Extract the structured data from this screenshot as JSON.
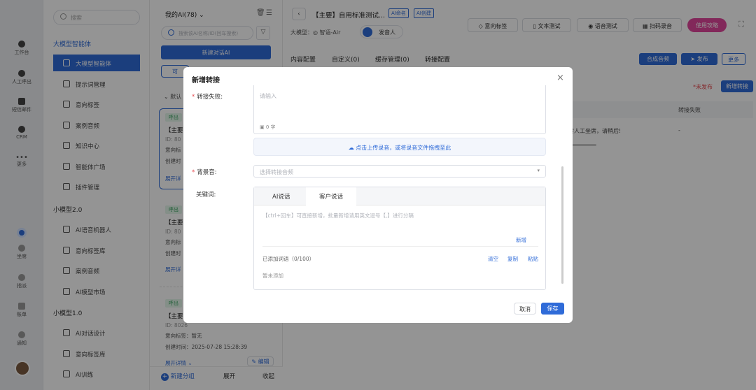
{
  "rail": {
    "items": [
      {
        "label": "工作台",
        "icon": "workbench-icon"
      },
      {
        "label": "人工呼出",
        "icon": "phone-icon"
      },
      {
        "label": "短信邮件",
        "icon": "message-icon"
      },
      {
        "label": "CRM",
        "icon": "crm-icon"
      },
      {
        "label": "更多",
        "icon": "more-icon"
      },
      {
        "label": "坐席",
        "icon": "headset-icon"
      },
      {
        "label": "指派",
        "icon": "assign-icon"
      },
      {
        "label": "账单",
        "icon": "bill-icon"
      },
      {
        "label": "通知",
        "icon": "bell-icon"
      }
    ]
  },
  "nav": {
    "search_placeholder": "搜索",
    "section1": "大模型智能体",
    "group1": [
      {
        "label": "大模型智能体",
        "icon": "agent-icon"
      },
      {
        "label": "提示词管理",
        "icon": "prompt-icon"
      },
      {
        "label": "意向标签",
        "icon": "tag-icon"
      },
      {
        "label": "案例音频",
        "icon": "audio-icon"
      },
      {
        "label": "知识中心",
        "icon": "book-icon"
      },
      {
        "label": "智能体广场",
        "icon": "square-icon"
      },
      {
        "label": "插件管理",
        "icon": "plugin-icon"
      }
    ],
    "section2": "小模型2.0",
    "group2": [
      {
        "label": "AI语音机器人",
        "icon": "robot-icon"
      },
      {
        "label": "意向标签库",
        "icon": "tag-icon"
      },
      {
        "label": "案例音频",
        "icon": "audio-icon"
      },
      {
        "label": "AI模型市场",
        "icon": "market-icon"
      }
    ],
    "section3": "小模型1.0",
    "group3": [
      {
        "label": "AI对话设计",
        "icon": "design-icon"
      },
      {
        "label": "意向标签库",
        "icon": "tag-icon"
      },
      {
        "label": "AI训练",
        "icon": "train-icon"
      }
    ]
  },
  "list": {
    "title": "我的AI(78)",
    "search_placeholder": "搜索该AI名称/ID(回车搜索)",
    "new_button": "新建对话AI",
    "sub_btn": "可",
    "default_group": "默认",
    "cards": [
      {
        "tag": "呼出",
        "title": "【主要",
        "id": "ID: 80",
        "line1": "意向标",
        "line2": "创建时",
        "expand": "展开详"
      },
      {
        "tag": "呼出",
        "title": "【主要",
        "id": "ID: 80",
        "line1": "意向标",
        "line2": "创建时",
        "expand": "展开详"
      },
      {
        "tag": "呼出",
        "title": "【主要",
        "id": "ID: 8026",
        "line1": "意向标签：暂无",
        "line2": "创建时间：2025-07-28 15:28:39",
        "expand": "展开详情",
        "edit": "编辑"
      }
    ],
    "footer": {
      "new_group": "新建分组",
      "expand": "展开",
      "collapse": "收起"
    }
  },
  "main": {
    "title": "【主要】自用标准测试...",
    "badge1": "AI命名",
    "badge2": "AI创建",
    "model_label": "大模型：",
    "model_value": "智语-Air",
    "voice": "发音人",
    "top_buttons": [
      "意向标签",
      "文本测试",
      "语音测试",
      "扫码录音"
    ],
    "guide": "使用攻略",
    "tabs": [
      "内容配置",
      "自定义(0)",
      "缓存管理(0)",
      "转接配置"
    ],
    "synth": "合成音频",
    "publish": "发布",
    "more": "更多",
    "unpublished": "*未发布",
    "new_transfer": "新增转接",
    "col_fail": "转接失败",
    "row_text": "转人工坐席，请稍后!",
    "row_dash": "-"
  },
  "modal": {
    "title": "新增转接",
    "fail_label": "转接失败:",
    "fail_placeholder": "请输入",
    "char_count": "0 字",
    "upload_text": "点击上传录音，或将录音文件拖拽至此",
    "bg_label": "背景音:",
    "bg_placeholder": "选择转接音频",
    "kw_label": "关键词:",
    "kw_tabs": [
      "AI说话",
      "客户说话"
    ],
    "kw_placeholder": "【ctrl+回车】可直接新增，批量新增请用英文逗号【,】进行分隔",
    "kw_add": "新增",
    "kw_count": "已添加词语（0/100）",
    "kw_clear": "清空",
    "kw_copy": "复制",
    "kw_paste": "粘贴",
    "kw_empty": "暂未添加",
    "cancel": "取消",
    "save": "保存"
  }
}
